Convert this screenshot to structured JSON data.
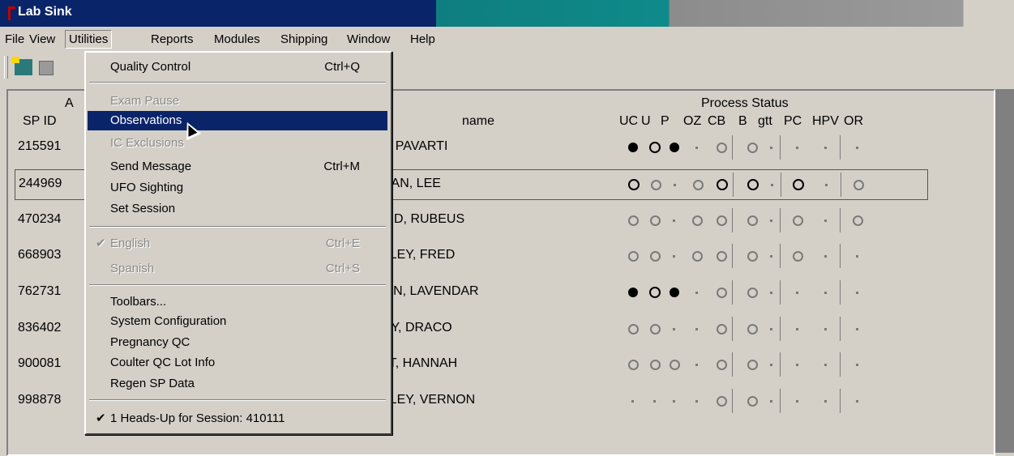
{
  "window": {
    "title": "Lab Sink"
  },
  "menubar": [
    "File",
    "View",
    "Utilities",
    "Reports",
    "Modules",
    "Shipping",
    "Window",
    "Help"
  ],
  "table": {
    "group_header_a": "A",
    "headers": {
      "sp_id": "SP ID",
      "name": "name",
      "process_status": "Process Status"
    },
    "status_cols": [
      "UC",
      "U",
      "P",
      "OZ",
      "CB",
      "B",
      "gtt",
      "PC",
      "HPV",
      "OR"
    ],
    "rows": [
      {
        "sp_id": "215591",
        "name": "L, PAVARTI",
        "st": [
          "f",
          "o",
          "f",
          "s",
          "g",
          "g",
          "s",
          "s",
          "s",
          "s"
        ]
      },
      {
        "sp_id": "244969",
        "name": "DAN, LEE",
        "st": [
          "o",
          "g",
          "s",
          "g",
          "o",
          "o",
          "s",
          "o",
          "s",
          "g"
        ]
      },
      {
        "sp_id": "470234",
        "name": "RID, RUBEUS",
        "st": [
          "g",
          "g",
          "s",
          "g",
          "g",
          "g",
          "s",
          "g",
          "s",
          "g"
        ]
      },
      {
        "sp_id": "668903",
        "name": "SLEY, FRED",
        "st": [
          "g",
          "g",
          "s",
          "g",
          "g",
          "g",
          "s",
          "g",
          "s",
          "s"
        ]
      },
      {
        "sp_id": "762731",
        "name": "WN, LAVENDAR",
        "st": [
          "f",
          "o",
          "f",
          "s",
          "g",
          "g",
          "s",
          "s",
          "s",
          "s"
        ]
      },
      {
        "sp_id": "836402",
        "name": "OY, DRACO",
        "st": [
          "g",
          "g",
          "s",
          "s",
          "g",
          "g",
          "s",
          "s",
          "s",
          "s"
        ]
      },
      {
        "sp_id": "900081",
        "name": "TT, HANNAH",
        "st": [
          "g",
          "g",
          "g",
          "s",
          "g",
          "g",
          "s",
          "s",
          "s",
          "s"
        ]
      },
      {
        "sp_id": "998878",
        "name": "SLEY, VERNON",
        "st": [
          "s",
          "s",
          "s",
          "s",
          "g",
          "g",
          "s",
          "s",
          "s",
          "s"
        ]
      }
    ]
  },
  "utilities_menu": {
    "quality_control": "Quality Control",
    "quality_control_sc": "Ctrl+Q",
    "exam_pause": "Exam Pause",
    "observations": "Observations",
    "ic_exclusions": "IC Exclusions",
    "send_message": "Send Message",
    "send_message_sc": "Ctrl+M",
    "ufo_sighting": "UFO Sighting",
    "set_session": "Set Session",
    "english": "English",
    "english_sc": "Ctrl+E",
    "spanish": "Spanish",
    "spanish_sc": "Ctrl+S",
    "toolbars": "Toolbars...",
    "system_configuration": "System Configuration",
    "pregnancy_qc": "Pregnancy QC",
    "coulter_qc": "Coulter QC Lot Info",
    "regen_sp": "Regen SP Data",
    "heads_up": "1 Heads-Up for Session: 410111"
  },
  "icons": {
    "check": "✔"
  }
}
